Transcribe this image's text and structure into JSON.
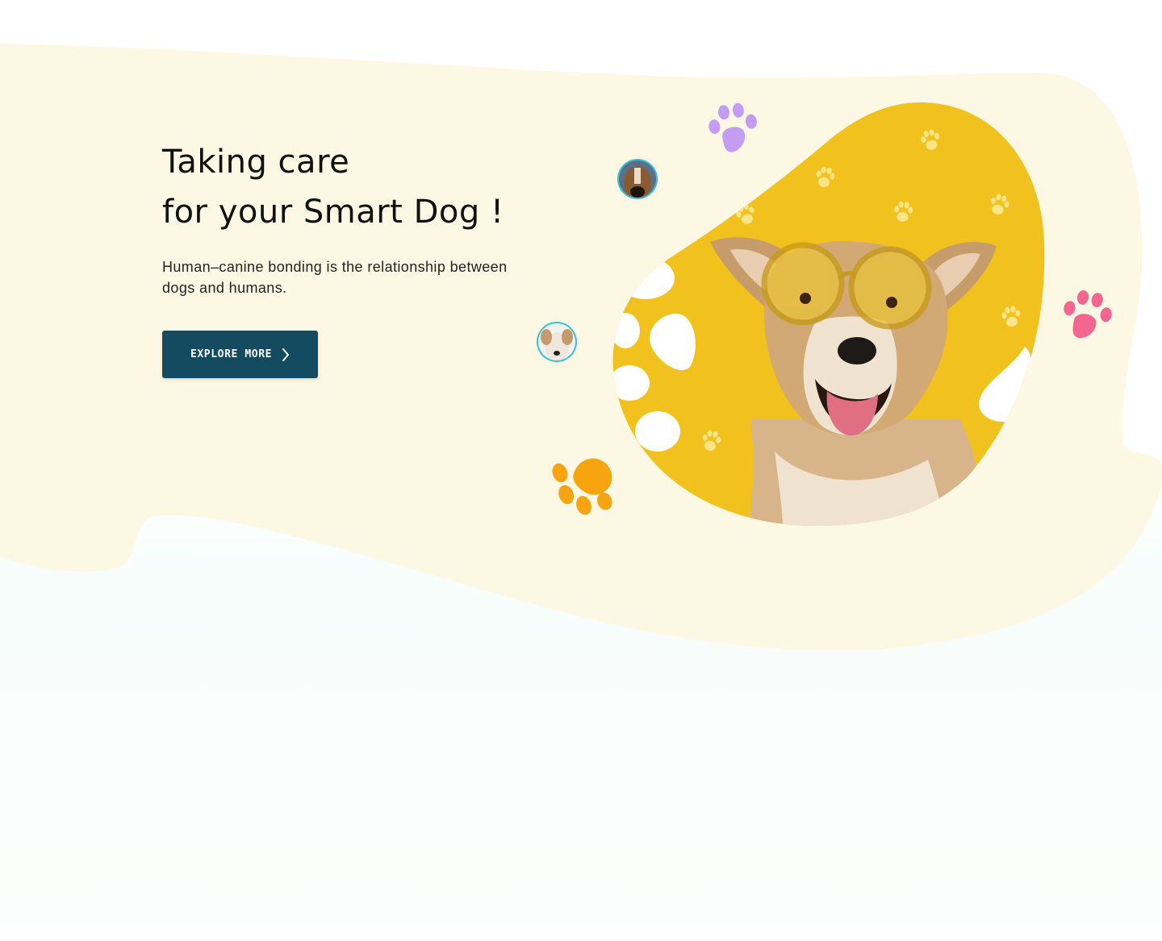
{
  "hero": {
    "title_line1": "Taking care",
    "title_line2": "for your Smart Dog !",
    "subtitle": "Human–canine bonding is the relationship between dogs and humans.",
    "cta_label": "EXPLORE MORE"
  },
  "icons": {
    "cta": "chevron-right-icon",
    "decor": [
      "paw-icon-purple",
      "paw-icon-pink",
      "paw-icon-orange"
    ]
  },
  "colors": {
    "hero_band": "#fdf8e4",
    "blob_yellow": "#f1c21d",
    "button": "#154b61",
    "paw_purple": "#c59cf4",
    "paw_pink": "#f2668f",
    "paw_orange": "#f8a310",
    "avatar_ring": "#39c1d8"
  }
}
